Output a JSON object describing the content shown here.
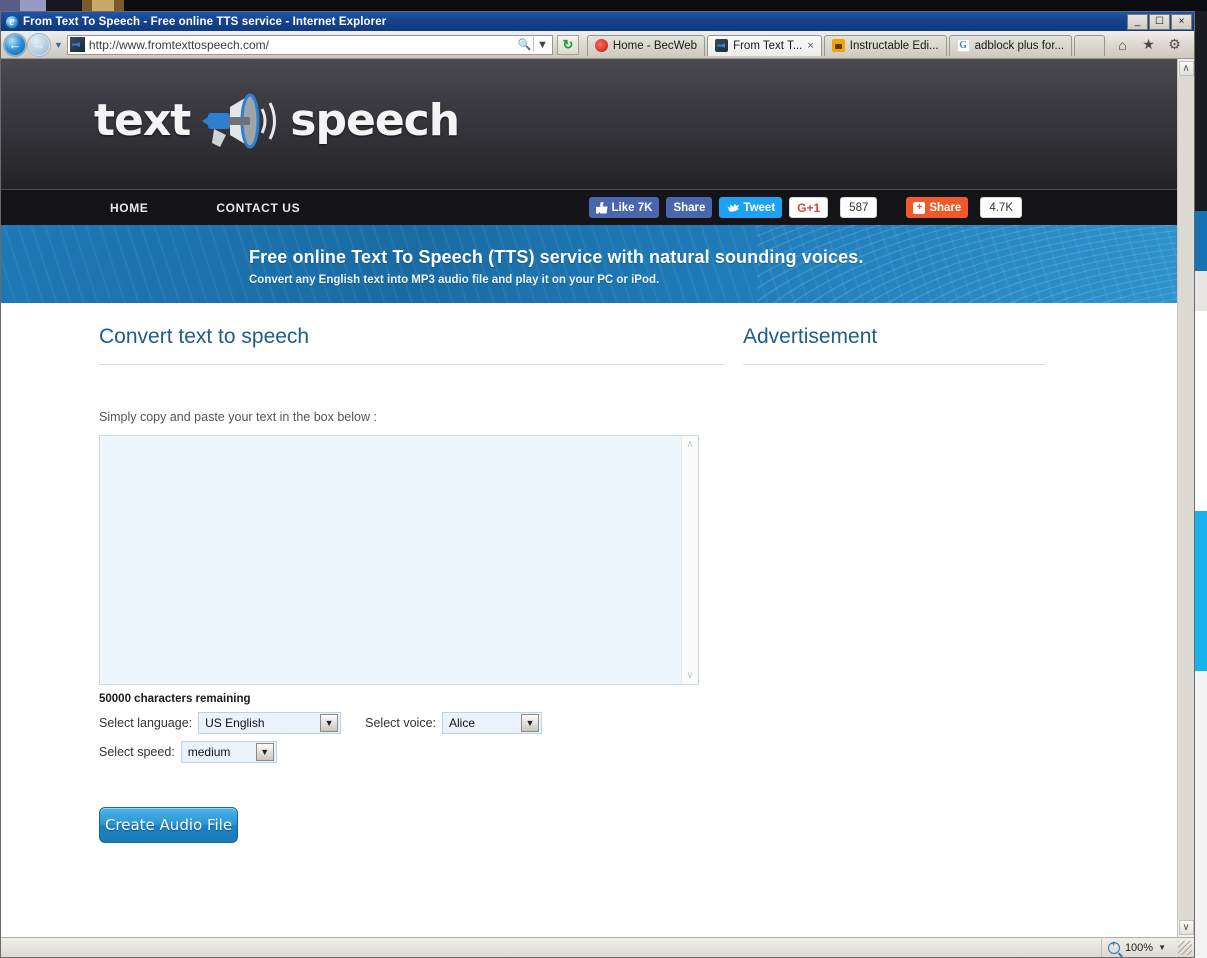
{
  "window": {
    "title": "From Text To Speech - Free online TTS service - Internet Explorer",
    "minimize_label": "_",
    "maximize_label": "☐",
    "close_label": "×"
  },
  "toolbar": {
    "back_icon": "back-arrow-icon",
    "forward_icon": "forward-arrow-icon",
    "history_icon": "chevron-down-icon",
    "url": "http://www.fromtexttospeech.com/",
    "search_icon": "search-icon",
    "dropdown_icon": "chevron-down-icon",
    "refresh_icon": "refresh-icon",
    "refresh_glyph": "↻",
    "home_icon": "home-icon",
    "favorites_icon": "star-icon",
    "settings_icon": "gear-icon"
  },
  "tabs": [
    {
      "label": "Home - BecWeb",
      "icon": "becweb-favicon",
      "active": false,
      "closable": false
    },
    {
      "label": "From Text T...",
      "icon": "tts-favicon",
      "active": true,
      "closable": true,
      "close_label": "×"
    },
    {
      "label": "Instructable Edi...",
      "icon": "instructables-favicon",
      "active": false,
      "closable": false
    },
    {
      "label": "adblock plus for...",
      "icon": "google-favicon",
      "active": false,
      "closable": false
    }
  ],
  "site": {
    "logo": {
      "word_left": "text",
      "word_right": "speech",
      "icon": "megaphone-icon"
    },
    "nav": [
      {
        "label": "HOME"
      },
      {
        "label": "CONTACT US"
      }
    ],
    "social": [
      {
        "name": "facebook-like",
        "label": "Like 7K",
        "icon": "thumbs-up-icon"
      },
      {
        "name": "facebook-share",
        "label": "Share",
        "icon": ""
      },
      {
        "name": "twitter-tweet",
        "label": "Tweet",
        "icon": "twitter-bird-icon"
      },
      {
        "name": "google-plus-one",
        "label": "G+1",
        "count": "587",
        "icon": "google-plus-icon"
      },
      {
        "name": "addthis-share",
        "label": "Share",
        "count": "4.7K",
        "icon": "addthis-icon"
      }
    ],
    "banner": {
      "title": "Free online Text To Speech (TTS) service with natural sounding voices.",
      "subtitle": "Convert any English text into MP3 audio file and play it on your PC or iPod."
    }
  },
  "main": {
    "section_title": "Convert text to speech",
    "ad_title": "Advertisement",
    "instruction": "Simply copy and paste your text in the box below :",
    "textarea_value": "",
    "textarea_placeholder": "",
    "char_count": "50000 characters remaining",
    "controls": {
      "language_label": "Select language:",
      "language_value": "US English",
      "voice_label": "Select voice:",
      "voice_value": "Alice",
      "speed_label": "Select speed:",
      "speed_value": "medium"
    },
    "submit_label": "Create Audio File"
  },
  "scroll": {
    "up_arrow": "∧",
    "down_arrow": "∨"
  },
  "statusbar": {
    "zoom_label": "100%",
    "zoom_icon": "zoom-magnifier-icon",
    "caret": "▼"
  },
  "colors": {
    "title_bar": "#17438c",
    "site_header": "#3c3c42",
    "nav_bar": "#141418",
    "banner_blue": "#1a6ba4",
    "heading_blue": "#1f5c8b",
    "button_blue": "#2a96d4",
    "textarea_bg": "#eef6fd",
    "facebook": "#4a66ad",
    "twitter": "#1da1f2",
    "google_red": "#db4437",
    "addthis_orange": "#f05a28"
  }
}
